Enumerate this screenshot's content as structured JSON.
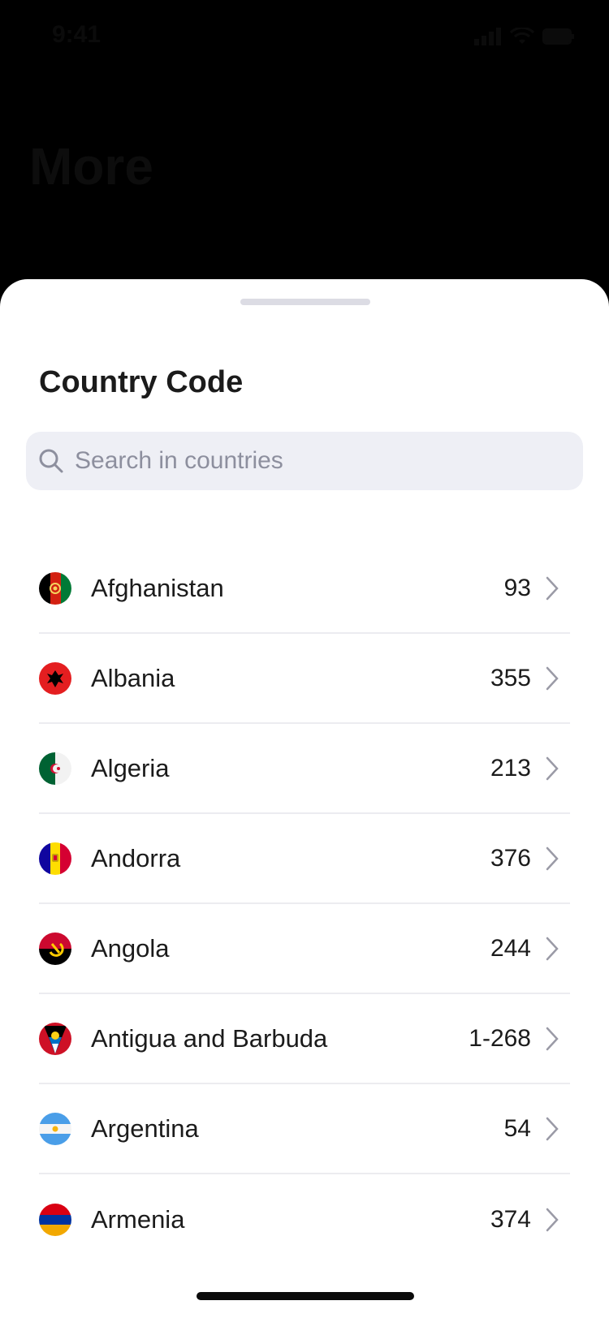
{
  "status": {
    "time": "9:41"
  },
  "background": {
    "title": "More"
  },
  "sheet": {
    "title": "Country Code",
    "search": {
      "placeholder": "Search in countries",
      "value": ""
    },
    "countries": [
      {
        "name": "Afghanistan",
        "code": "93"
      },
      {
        "name": "Albania",
        "code": "355"
      },
      {
        "name": "Algeria",
        "code": "213"
      },
      {
        "name": "Andorra",
        "code": "376"
      },
      {
        "name": "Angola",
        "code": "244"
      },
      {
        "name": "Antigua and Barbuda",
        "code": "1-268"
      },
      {
        "name": "Argentina",
        "code": "54"
      },
      {
        "name": "Armenia",
        "code": "374"
      }
    ]
  },
  "colors": {
    "background": "#000000",
    "sheet": "#ffffff",
    "search_bg": "#eeeff5",
    "placeholder": "#8d8f9e",
    "divider": "#ececf0",
    "text": "#1b1b1b"
  }
}
